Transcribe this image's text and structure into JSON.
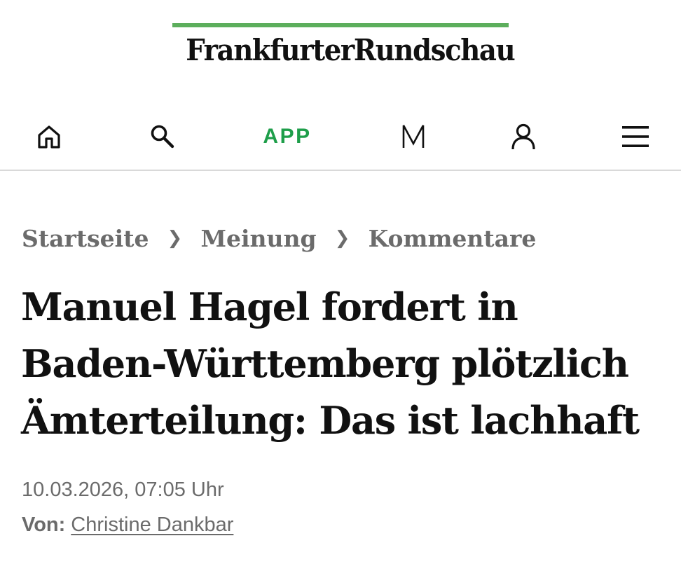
{
  "colors": {
    "brand_green": "#5cae5c",
    "app_green": "#1e9e4a",
    "text_dark": "#111111",
    "text_gray": "#6b6b6b",
    "divider": "#d9d9d9"
  },
  "masthead": {
    "logo_text": "FrankfurterRundschau"
  },
  "nav": {
    "items": [
      {
        "icon": "home-icon"
      },
      {
        "icon": "search-icon"
      },
      {
        "label": "APP"
      },
      {
        "icon": "merkzettel-m-icon"
      },
      {
        "icon": "user-icon"
      },
      {
        "icon": "hamburger-menu-icon"
      }
    ]
  },
  "breadcrumb": {
    "items": [
      "Startseite",
      "Meinung",
      "Kommentare"
    ],
    "separator": "❯"
  },
  "article": {
    "headline_lines": [
      "Manuel Hagel fordert in",
      "Baden-Württemberg plötzlich",
      "Ämterteilung: Das ist lachhaft"
    ],
    "dateline": "10.03.2026, 07:05 Uhr",
    "byline_label": "Von:",
    "author": "Christine Dankbar"
  }
}
